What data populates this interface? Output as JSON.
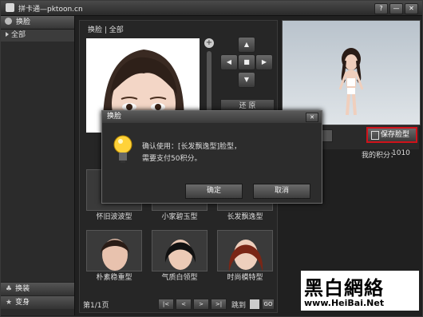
{
  "window": {
    "title": "拼卡通—pktoon.cn",
    "help_btn": "?",
    "min_btn": "—",
    "close_btn": "✕"
  },
  "sidebar": {
    "header": "换脸",
    "items": [
      {
        "label": "全部"
      }
    ],
    "bottom_tabs": [
      {
        "label": "换装"
      },
      {
        "label": "变身"
      }
    ]
  },
  "main": {
    "breadcrumb": "换脸 | 全部",
    "restore_label": "还 原",
    "faces": [
      {
        "label": "怀旧波波型"
      },
      {
        "label": "小家碧玉型"
      },
      {
        "label": "长发飘逸型"
      },
      {
        "label": "朴素稳重型"
      },
      {
        "label": "气质白领型"
      },
      {
        "label": "时尚模特型"
      }
    ],
    "pager": {
      "page_label": "第1/1页",
      "first": "|<",
      "prev": "<",
      "next": ">",
      "last": ">|",
      "jump_label": "跳到",
      "go": "GO"
    }
  },
  "right": {
    "save_label": "保存脸型",
    "points_label": "我的积分：",
    "points_value": "1010"
  },
  "dialog": {
    "title": "换脸",
    "close": "✕",
    "line1": "确认使用：[长发飘逸型]脸型，",
    "line2": "需要支付50积分。",
    "ok": "确定",
    "cancel": "取消"
  },
  "watermark": {
    "text": "黑白網絡",
    "url": "www.HeiBai.Net"
  }
}
